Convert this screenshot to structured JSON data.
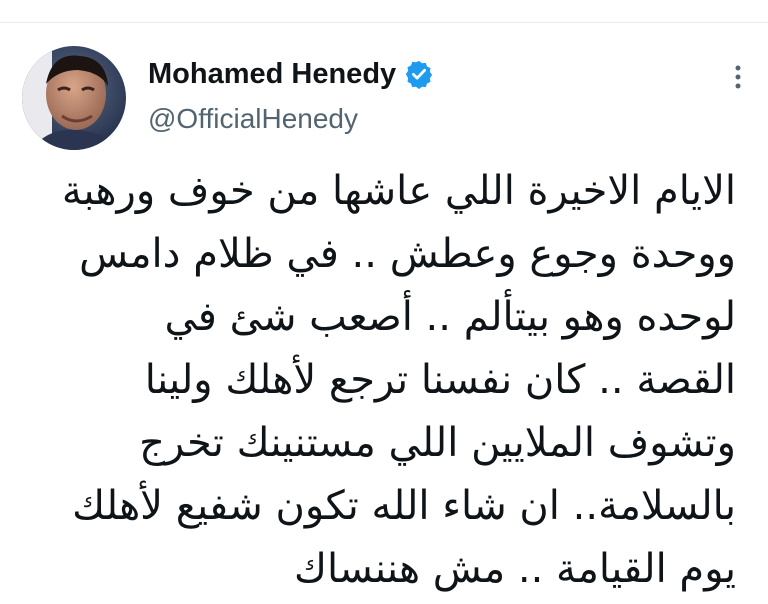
{
  "tweet": {
    "author": {
      "display_name": "Mohamed Henedy",
      "handle": "@OfficialHenedy",
      "verified_icon": "verified-badge-icon",
      "avatar": "avatar-photo"
    },
    "more_icon": "more-options-icon",
    "text_lines": [
      "الايام الاخيرة اللي عاشها من خوف ورهبة",
      "ووحدة وجوع وعطش .. في ظلام دامس",
      "لوحده وهو بيتألم .. أصعب شئ في",
      "القصة .. كان نفسنا ترجع لأهلك ولينا",
      "وتشوف الملايين اللي مستنينك تخرج",
      "بالسلامة.. ان شاء الله تكون شفيع لأهلك",
      "يوم القيامة .. مش هننساك"
    ]
  },
  "colors": {
    "text_primary": "#0f1419",
    "text_secondary": "#536471",
    "verified_blue": "#1d9bf0",
    "divider": "#e6ecf0"
  }
}
